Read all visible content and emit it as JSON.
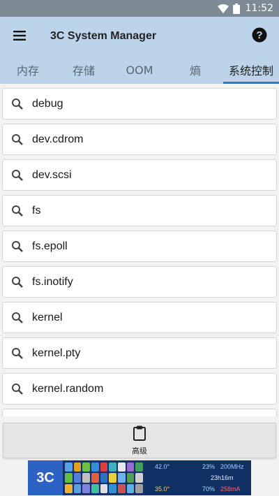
{
  "status_bar": {
    "time": "11:52"
  },
  "app_bar": {
    "title": "3C System Manager",
    "menu_icon": "hamburger-menu-icon",
    "help_icon": "help-circle-icon"
  },
  "tabs": [
    {
      "label": "内存",
      "active": false
    },
    {
      "label": "存储",
      "active": false
    },
    {
      "label": "OOM",
      "active": false
    },
    {
      "label": "熵",
      "active": false
    },
    {
      "label": "系统控制",
      "active": true
    }
  ],
  "list": {
    "items": [
      {
        "label": "debug"
      },
      {
        "label": "dev.cdrom"
      },
      {
        "label": "dev.scsi"
      },
      {
        "label": "fs"
      },
      {
        "label": "fs.epoll"
      },
      {
        "label": "fs.inotify"
      },
      {
        "label": "kernel"
      },
      {
        "label": "kernel.pty"
      },
      {
        "label": "kernel.random"
      }
    ]
  },
  "bottom_button": {
    "label": "高级",
    "icon": "clipboard-icon"
  },
  "ad": {
    "logo_text": "3C",
    "values": [
      "42.0°",
      "23%",
      "200MHz",
      "23h16m",
      "70%",
      "258mA",
      "35.0°"
    ]
  },
  "colors": {
    "app_bar_bg": "#bcd4ea",
    "status_bar_bg": "#7e8a96",
    "tab_indicator": "#2a7ad0"
  }
}
